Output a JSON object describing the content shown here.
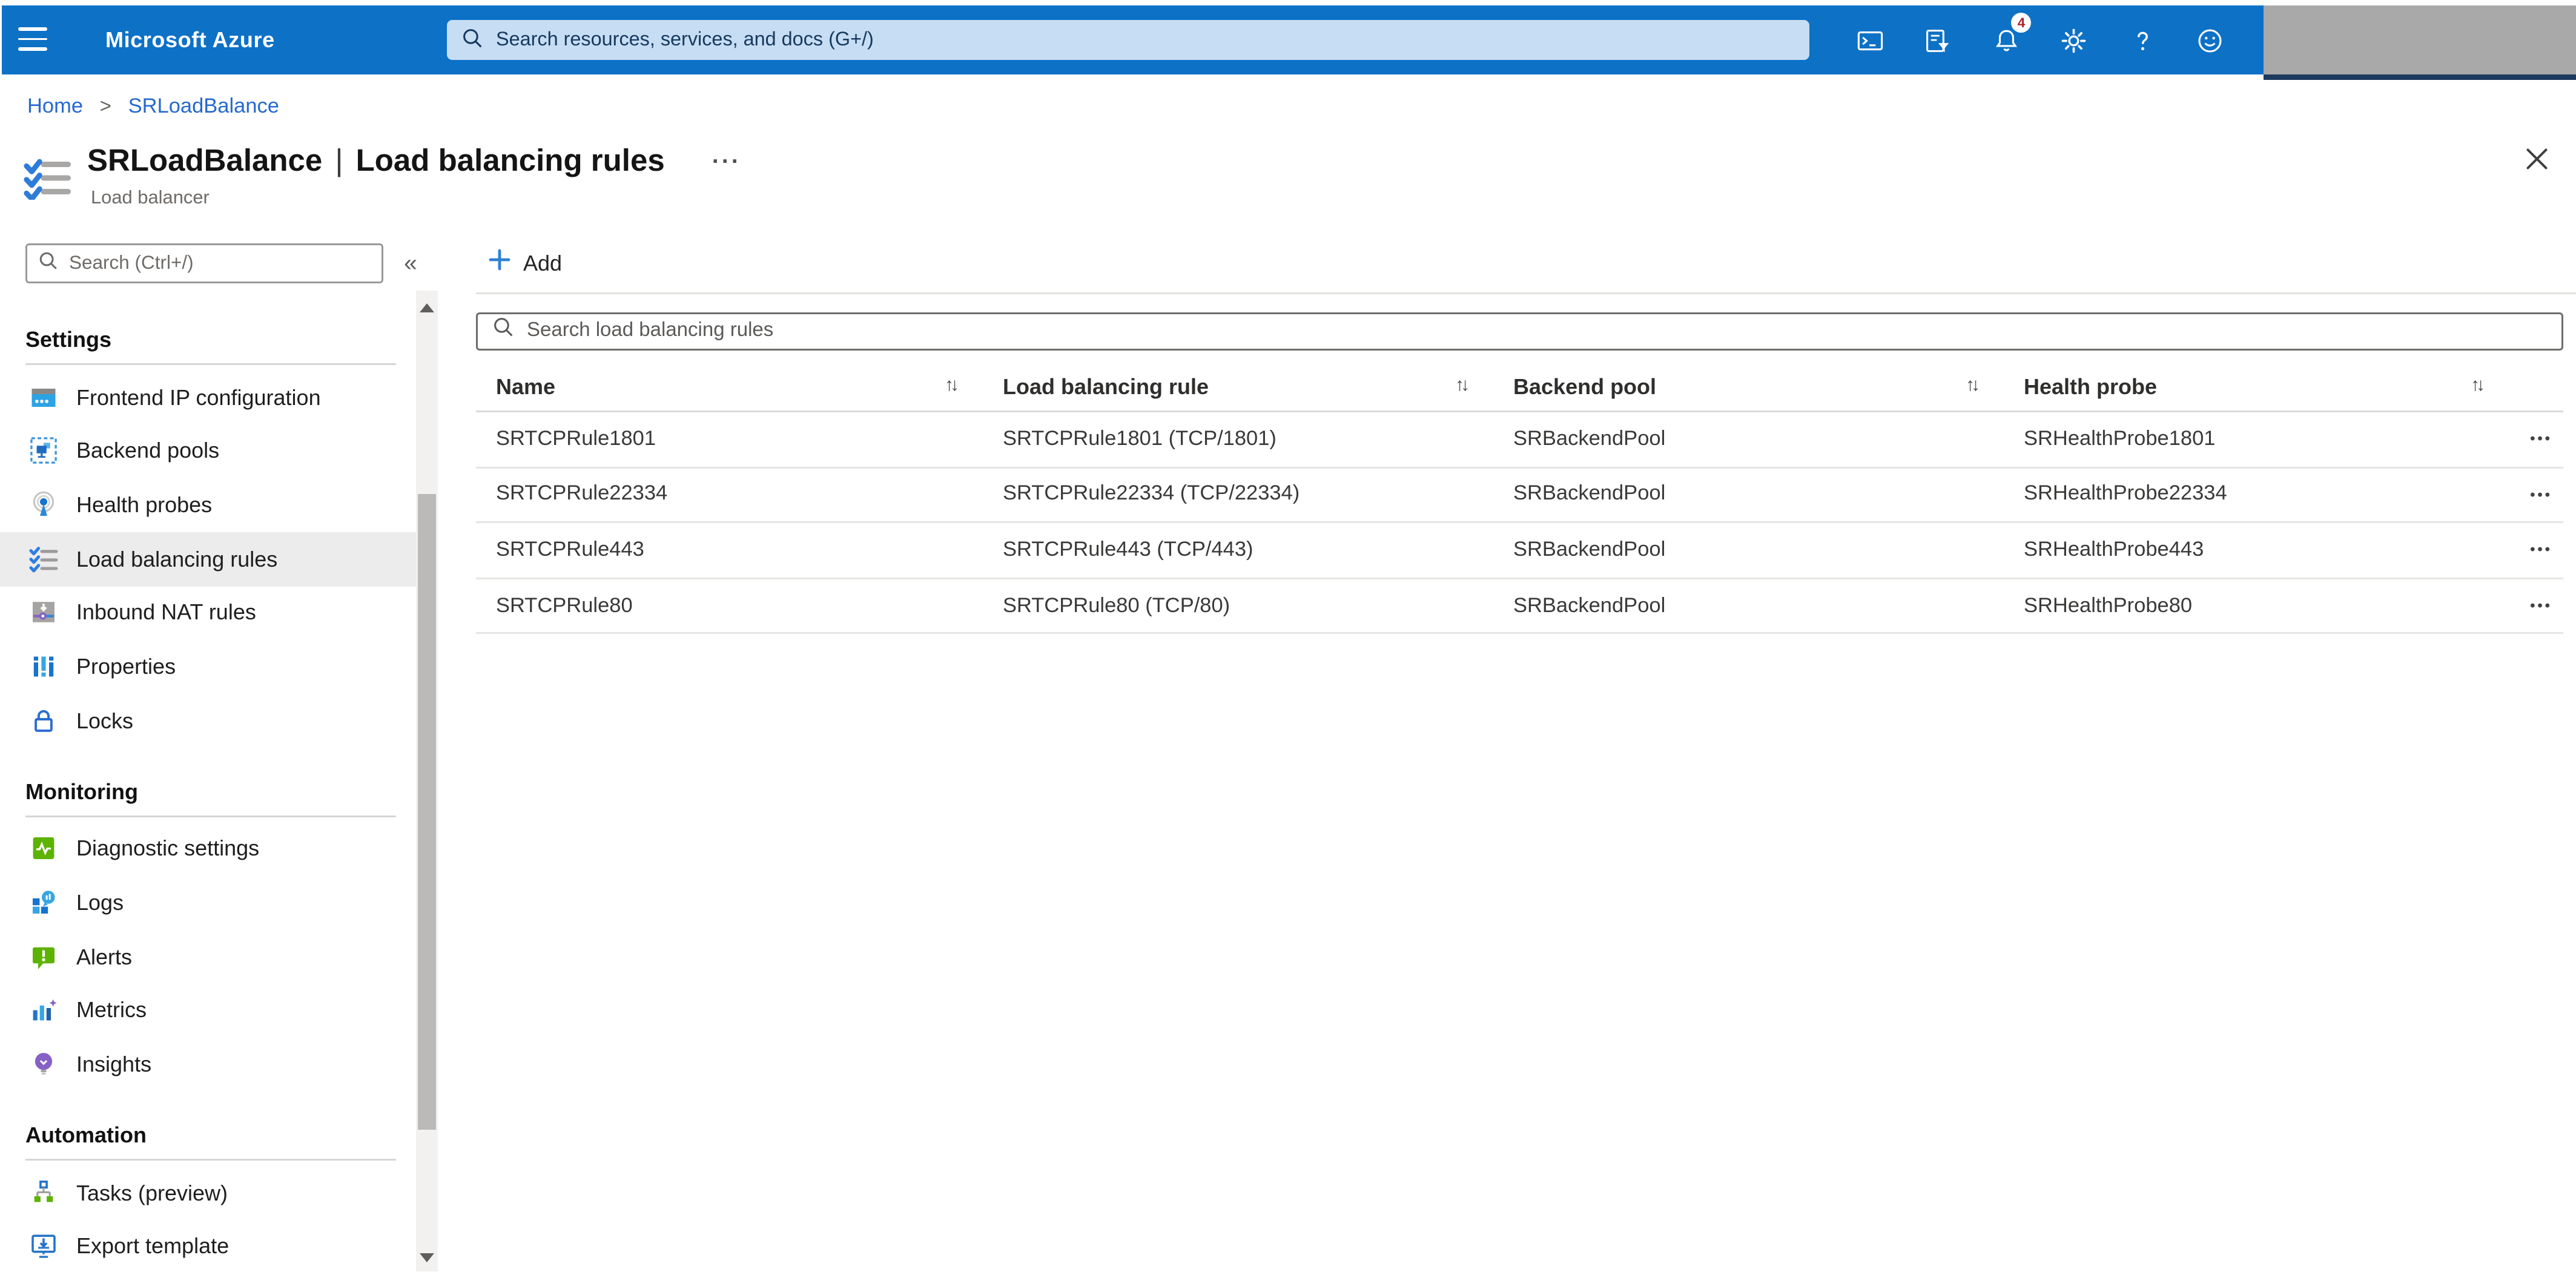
{
  "topbar": {
    "brand": "Microsoft Azure",
    "search": {
      "placeholder": "Search resources, services, and docs (G+/)"
    },
    "icons": [
      {
        "name": "cloud-shell-icon"
      },
      {
        "name": "directory-filter-icon"
      },
      {
        "name": "notifications-bell-icon",
        "badge": "4"
      },
      {
        "name": "settings-gear-icon"
      },
      {
        "name": "help-icon"
      },
      {
        "name": "feedback-smiley-icon"
      }
    ]
  },
  "breadcrumb": {
    "items": [
      "Home",
      "SRLoadBalance"
    ],
    "separator": ">"
  },
  "page": {
    "title_resource": "SRLoadBalance",
    "title_divider": "|",
    "title_section": "Load balancing rules",
    "subtitle": "Load balancer",
    "more_glyph": "···",
    "icon": "load-balancing-rules-icon",
    "close_icon": "close-x-icon"
  },
  "sidebar": {
    "search_placeholder": "Search (Ctrl+/)",
    "collapse_glyph": "«",
    "sections": [
      {
        "header": "Settings",
        "items": [
          {
            "label": "Frontend IP configuration",
            "icon": "frontend-ip"
          },
          {
            "label": "Backend pools",
            "icon": "backend-pools"
          },
          {
            "label": "Health probes",
            "icon": "health-probes"
          },
          {
            "label": "Load balancing rules",
            "icon": "lb-rules",
            "selected": true
          },
          {
            "label": "Inbound NAT rules",
            "icon": "inbound-nat"
          },
          {
            "label": "Properties",
            "icon": "properties"
          },
          {
            "label": "Locks",
            "icon": "locks"
          }
        ]
      },
      {
        "header": "Monitoring",
        "items": [
          {
            "label": "Diagnostic settings",
            "icon": "diagnostics"
          },
          {
            "label": "Logs",
            "icon": "logs"
          },
          {
            "label": "Alerts",
            "icon": "alerts"
          },
          {
            "label": "Metrics",
            "icon": "metrics"
          },
          {
            "label": "Insights",
            "icon": "insights"
          }
        ]
      },
      {
        "header": "Automation",
        "items": [
          {
            "label": "Tasks (preview)",
            "icon": "tasks"
          },
          {
            "label": "Export template",
            "icon": "export-template"
          }
        ]
      }
    ]
  },
  "main": {
    "commands": [
      {
        "label": "Add",
        "icon": "plus-icon"
      }
    ],
    "search_placeholder": "Search load balancing rules",
    "table": {
      "sort_glyph": "↑↓",
      "row_menu_glyph": "•••",
      "columns": [
        "Name",
        "Load balancing rule",
        "Backend pool",
        "Health probe"
      ],
      "rows": [
        {
          "name": "SRTCPRule1801",
          "rule": "SRTCPRule1801 (TCP/1801)",
          "backend_pool": "SRBackendPool",
          "health_probe": "SRHealthProbe1801"
        },
        {
          "name": "SRTCPRule22334",
          "rule": "SRTCPRule22334 (TCP/22334)",
          "backend_pool": "SRBackendPool",
          "health_probe": "SRHealthProbe22334"
        },
        {
          "name": "SRTCPRule443",
          "rule": "SRTCPRule443 (TCP/443)",
          "backend_pool": "SRBackendPool",
          "health_probe": "SRHealthProbe443"
        },
        {
          "name": "SRTCPRule80",
          "rule": "SRTCPRule80 (TCP/80)",
          "backend_pool": "SRBackendPool",
          "health_probe": "SRHealthProbe80"
        }
      ]
    }
  },
  "colors": {
    "topbar": "#0d71c6",
    "topbar_search_bg": "#c7ddf4",
    "accent": "#0078d4",
    "link": "#2669cf",
    "badge_text": "#a4262c",
    "selected_item_bg": "#ececec",
    "account_redacted": "#a9a9a9"
  }
}
